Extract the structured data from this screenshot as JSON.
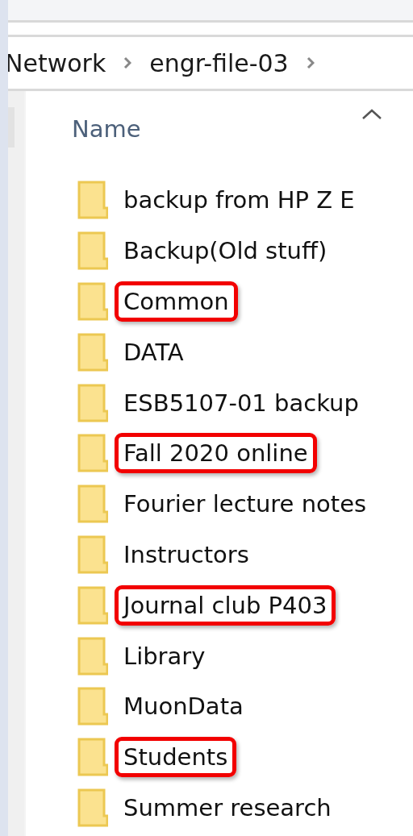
{
  "breadcrumb": [
    "Network",
    "engr-file-03"
  ],
  "column_header": {
    "label": "Name"
  },
  "folders": [
    {
      "name": "backup from HP Z E",
      "highlighted": false
    },
    {
      "name": "Backup(Old stuff)",
      "highlighted": false
    },
    {
      "name": "Common",
      "highlighted": true
    },
    {
      "name": "DATA",
      "highlighted": false
    },
    {
      "name": "ESB5107-01 backup",
      "highlighted": false
    },
    {
      "name": "Fall 2020 online",
      "highlighted": true
    },
    {
      "name": "Fourier lecture notes",
      "highlighted": false
    },
    {
      "name": "Instructors",
      "highlighted": false
    },
    {
      "name": "Journal club P403",
      "highlighted": true
    },
    {
      "name": "Library",
      "highlighted": false
    },
    {
      "name": "MuonData",
      "highlighted": false
    },
    {
      "name": "Students",
      "highlighted": true
    },
    {
      "name": "Summer research",
      "highlighted": false
    }
  ]
}
